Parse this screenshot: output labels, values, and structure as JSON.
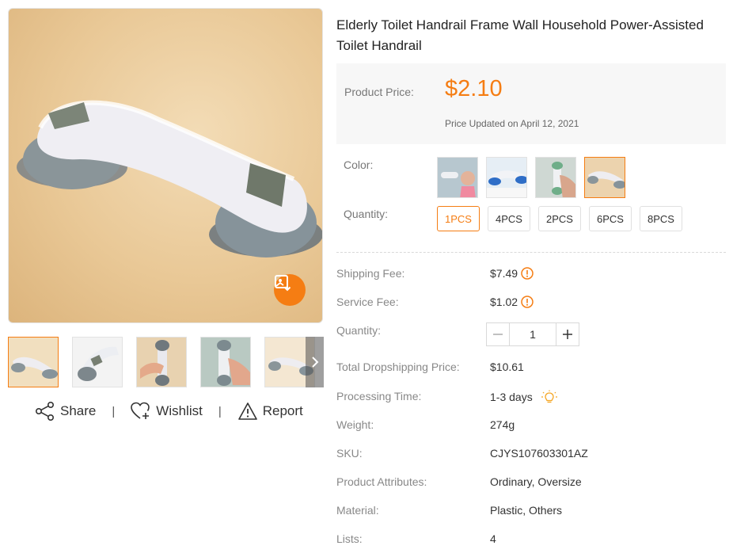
{
  "product": {
    "title": "Elderly Toilet Handrail Frame Wall Household Power-Assisted Toilet Handrail"
  },
  "gallery": {
    "thumbnail_count": 5,
    "active_thumbnail": 0
  },
  "actions": {
    "share": "Share",
    "wishlist": "Wishlist",
    "report": "Report",
    "separator": "|"
  },
  "price": {
    "label": "Product Price:",
    "value": "$2.10",
    "updated": "Price Updated on April 12, 2021"
  },
  "options": {
    "color_label": "Color:",
    "color_swatch_count": 4,
    "selected_color_index": 3,
    "quantity_label": "Quantity:",
    "quantity_options": [
      "1PCS",
      "4PCS",
      "2PCS",
      "6PCS",
      "8PCS"
    ],
    "selected_quantity": "1PCS"
  },
  "details": {
    "shipping_fee": {
      "label": "Shipping Fee:",
      "value": "$7.49"
    },
    "service_fee": {
      "label": "Service Fee:",
      "value": "$1.02"
    },
    "quantity": {
      "label": "Quantity:",
      "value": "1"
    },
    "total": {
      "label": "Total Dropshipping Price:",
      "value": "$10.61"
    },
    "processing_time": {
      "label": "Processing Time:",
      "value": "1-3 days"
    },
    "weight": {
      "label": "Weight:",
      "value": "274g"
    },
    "sku": {
      "label": "SKU:",
      "value": "CJYS107603301AZ"
    },
    "attributes": {
      "label": "Product Attributes:",
      "value": "Ordinary, Oversize"
    },
    "material": {
      "label": "Material:",
      "value": "Plastic, Others"
    },
    "lists": {
      "label": "Lists:",
      "value": "4"
    }
  },
  "colors": {
    "accent": "#f57d13",
    "muted_text": "#888888",
    "price_box_bg": "#f7f7f7"
  },
  "icons": {
    "image_search": "image-search-icon",
    "share": "share-icon",
    "wishlist": "heart-plus-icon",
    "report": "warning-icon",
    "fee_info": "exclamation-circle-icon",
    "processing": "lightbulb-icon",
    "next": "chevron-right-icon"
  }
}
